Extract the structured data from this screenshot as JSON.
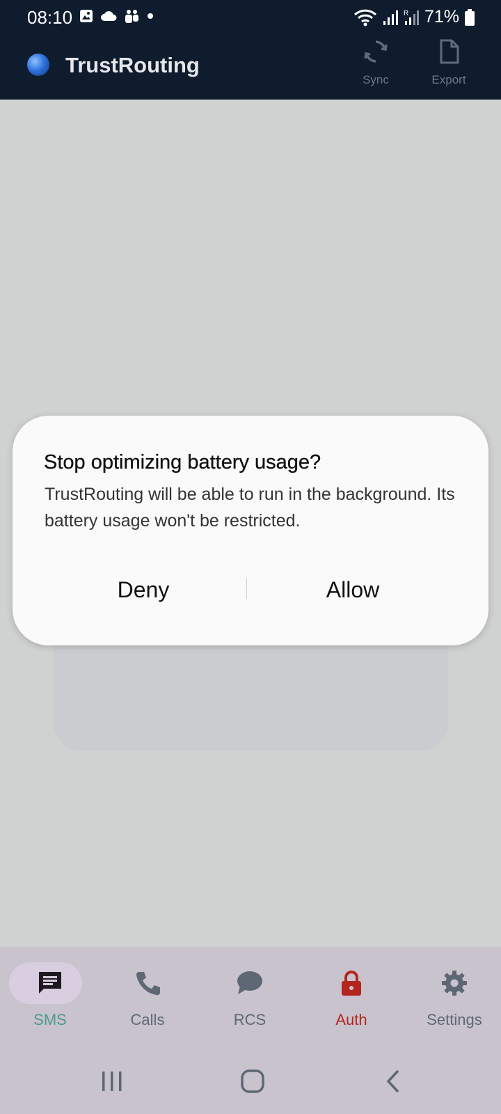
{
  "status_bar": {
    "time": "08:10",
    "battery": "71%",
    "icons": [
      "image-notification-icon",
      "cloud-icon",
      "teams-icon",
      "dot-icon",
      "wifi-icon",
      "signal-icon",
      "signal-roaming-icon",
      "battery-icon"
    ]
  },
  "app_bar": {
    "title": "TrustRouting",
    "actions": [
      {
        "label": "Sync",
        "icon": "sync-icon"
      },
      {
        "label": "Export",
        "icon": "document-icon"
      }
    ],
    "colors": {
      "background": "#0f1c2e",
      "title": "#e5e7ea"
    }
  },
  "dialog": {
    "title": "Stop optimizing battery usage?",
    "body": "TrustRouting will be able to run in the background. Its battery usage won't be restricted.",
    "deny_label": "Deny",
    "allow_label": "Allow"
  },
  "bottom_nav": {
    "items": [
      {
        "label": "SMS",
        "icon": "message-icon",
        "color": "#4d9b8a",
        "selected": true
      },
      {
        "label": "Calls",
        "icon": "phone-icon",
        "color": "#5e6774"
      },
      {
        "label": "RCS",
        "icon": "chat-bubble-icon",
        "color": "#5e6774"
      },
      {
        "label": "Auth",
        "icon": "lock-icon",
        "color": "#b3261e"
      },
      {
        "label": "Settings",
        "icon": "gear-icon",
        "color": "#5e6774"
      }
    ]
  },
  "system_nav": {
    "icons": [
      "recent-apps-icon",
      "home-icon",
      "back-icon"
    ]
  }
}
